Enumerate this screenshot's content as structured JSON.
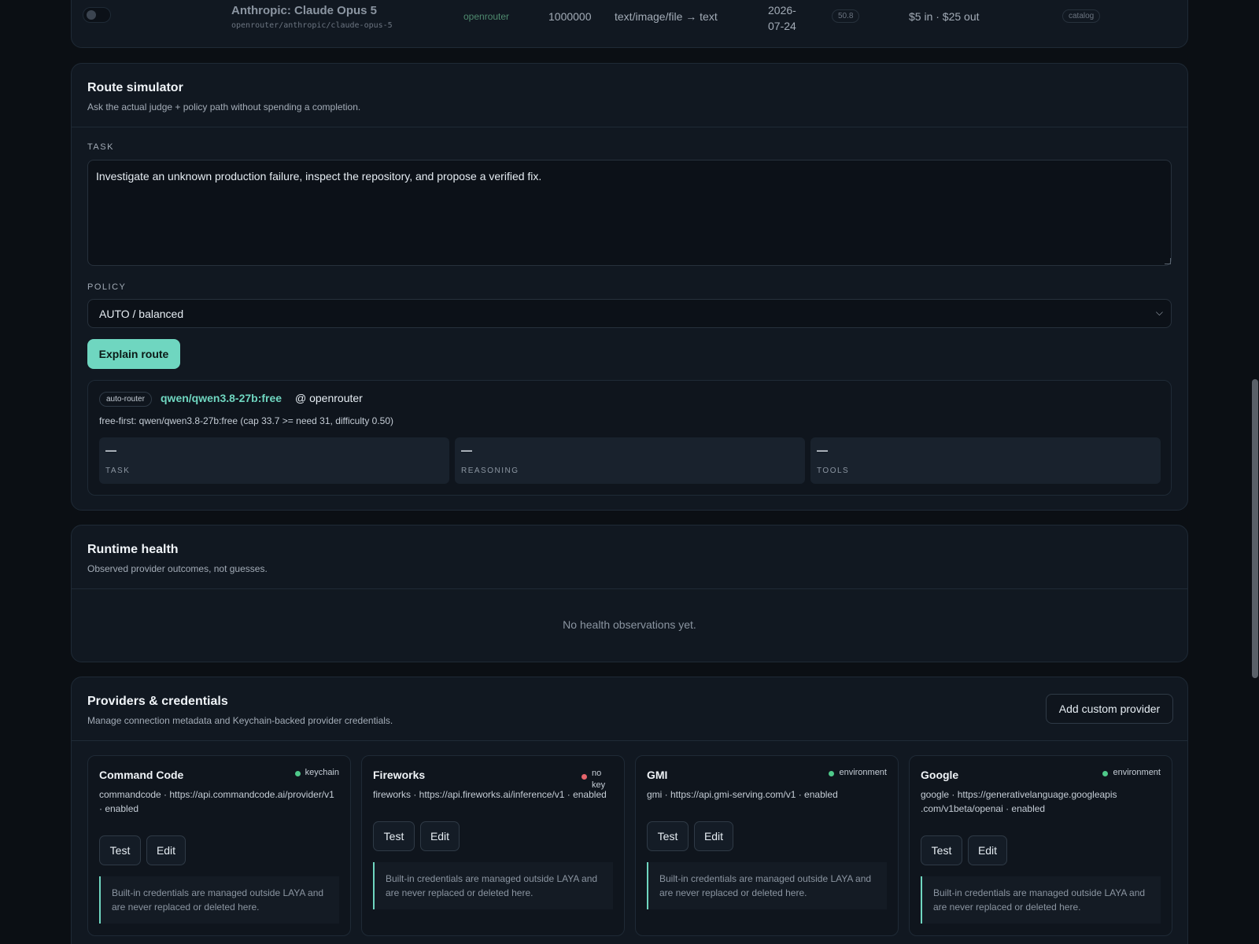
{
  "model_row": {
    "name": "Anthropic: Claude Opus 5",
    "id": "openrouter/anthropic/claude-opus-5",
    "provider": "openrouter",
    "context": "1000000",
    "modalities": "text/image/file → text",
    "date": "2026-07-24",
    "score": "50.8",
    "price": "$5 in · $25 out",
    "source_tag": "catalog",
    "enabled": false
  },
  "route_simulator": {
    "title": "Route simulator",
    "subtitle": "Ask the actual judge + policy path without spending a completion.",
    "task_label": "TASK",
    "task_value": "Investigate an unknown production failure, inspect the repository, and propose a verified fix.",
    "policy_label": "POLICY",
    "policy_value": "AUTO / balanced",
    "explain_label": "Explain route",
    "result": {
      "badge": "auto-router",
      "model": "qwen/qwen3.8-27b:free",
      "at": "@ openrouter",
      "reason": "free-first: qwen/qwen3.8-27b:free (cap 33.7 >= need 31, difficulty 0.50)",
      "metrics": [
        {
          "value": "—",
          "label": "TASK"
        },
        {
          "value": "—",
          "label": "REASONING"
        },
        {
          "value": "—",
          "label": "TOOLS"
        }
      ]
    }
  },
  "runtime_health": {
    "title": "Runtime health",
    "subtitle": "Observed provider outcomes, not guesses.",
    "empty": "No health observations yet."
  },
  "providers": {
    "title": "Providers & credentials",
    "subtitle": "Manage connection metadata and Keychain-backed provider credentials.",
    "add_label": "Add custom provider",
    "test_label": "Test",
    "edit_label": "Edit",
    "note": "Built-in credentials are managed outside LAYA and are never replaced or deleted here.",
    "status_colors": {
      "ok": "#4ec98a",
      "missing": "#e5646b"
    },
    "cards": [
      {
        "name": "Command Code",
        "status": "keychain",
        "status_kind": "ok",
        "desc": "commandcode · https://api.commandcode.ai/provider/v1 · enabled"
      },
      {
        "name": "Fireworks",
        "status": "no key",
        "status_kind": "missing",
        "desc": "fireworks · https://api.fireworks.ai/inference/v1 · enabled"
      },
      {
        "name": "GMI",
        "status": "environment",
        "status_kind": "ok",
        "desc": "gmi · https://api.gmi-serving.com/v1 · enabled"
      },
      {
        "name": "Google",
        "status": "environment",
        "status_kind": "ok",
        "desc": "google · https://generativelanguage.googleapis .com/v1beta/openai · enabled"
      }
    ]
  },
  "accent_color": "#6fd6c0"
}
